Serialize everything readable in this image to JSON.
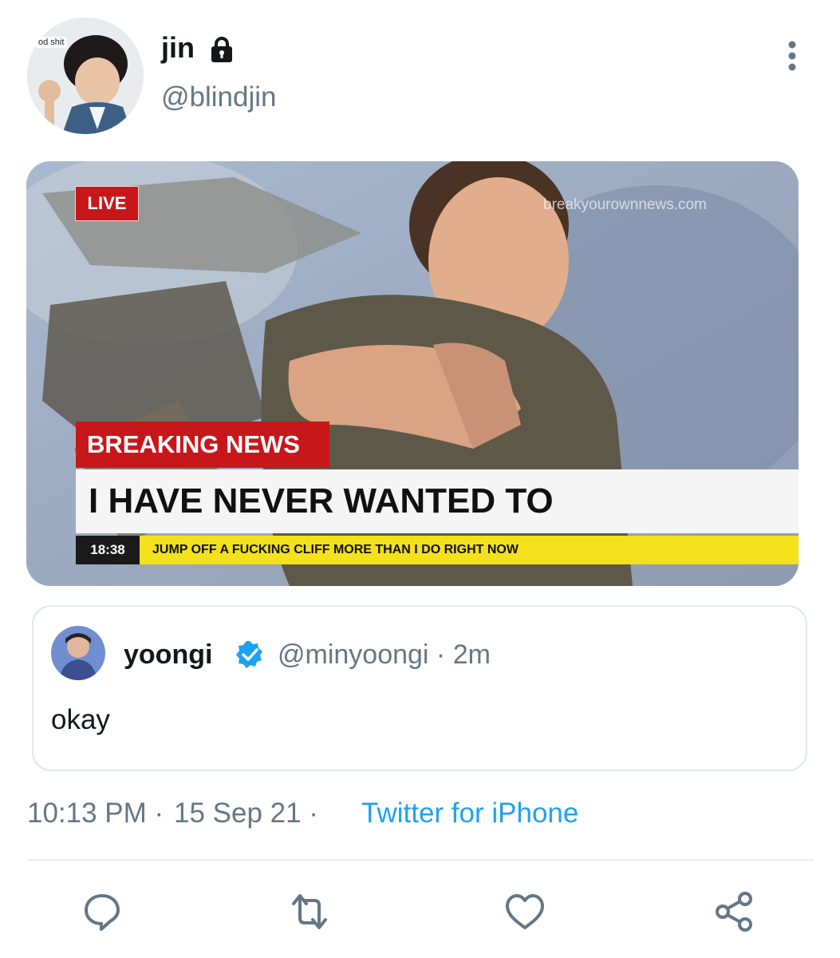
{
  "tweet": {
    "display_name": "jin",
    "handle": "@blindjin",
    "avatar_sticker_text": "od shit",
    "more_icon": "more-vertical-icon",
    "lock_icon": "lock-icon"
  },
  "media": {
    "live": "LIVE",
    "watermark": "breakyourownnews.com",
    "breaking": "BREAKING NEWS",
    "headline": "I HAVE NEVER WANTED TO",
    "clock": "18:38",
    "ticker": "JUMP OFF A FUCKING CLIFF MORE THAN I DO RIGHT NOW"
  },
  "quote": {
    "name": "yoongi",
    "handle_time": "@minyoongi · 2m",
    "text": "okay"
  },
  "meta": {
    "time": "10:13 PM ·",
    "date": "15 Sep 21 ·",
    "source": "Twitter for iPhone"
  },
  "actions": [
    "reply-icon",
    "retweet-icon",
    "like-icon",
    "share-icon"
  ],
  "colors": {
    "link_blue": "#1da1f2",
    "secondary_text": "#657786",
    "breaking_red": "#c8171b",
    "ticker_yellow": "#f2e11b"
  }
}
